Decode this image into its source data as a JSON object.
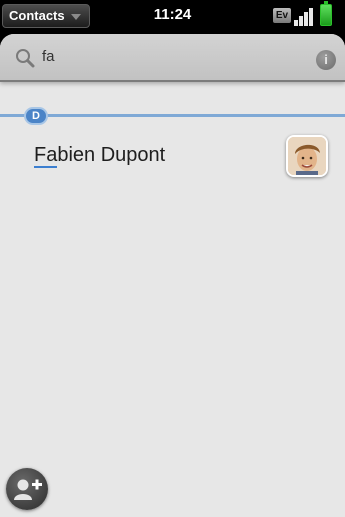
{
  "status_bar": {
    "app_menu_label": "Contacts",
    "time": "11:24",
    "network_label": "Ev",
    "battery_color": "#2bc12b"
  },
  "search": {
    "query": "fa",
    "clear_icon": "info-icon"
  },
  "section": {
    "letter": "D"
  },
  "contacts": [
    {
      "match": "Fa",
      "rest": "bien Dupont",
      "avatar": "person-photo"
    }
  ],
  "actions": {
    "add_icon": "add-contact-icon"
  },
  "colors": {
    "accent": "#4b84c7",
    "card_bg": "#e7e7e7"
  }
}
